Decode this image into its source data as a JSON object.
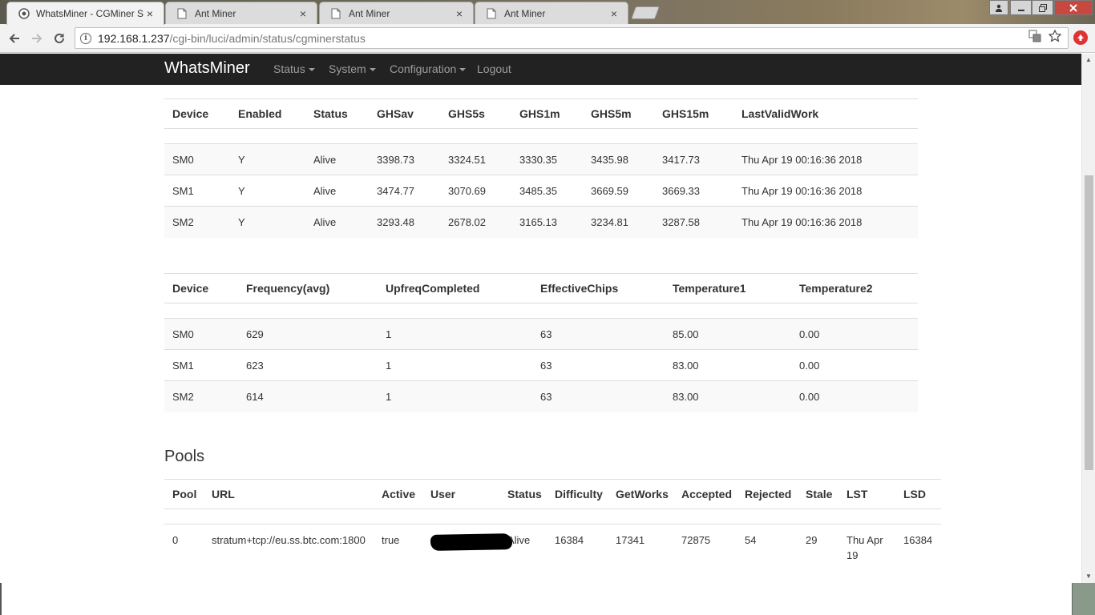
{
  "browser": {
    "tabs": [
      {
        "title": "WhatsMiner - CGMiner S",
        "icon": "miner-favicon",
        "active": true
      },
      {
        "title": "Ant Miner",
        "icon": "page-icon",
        "active": false
      },
      {
        "title": "Ant Miner",
        "icon": "page-icon",
        "active": false
      },
      {
        "title": "Ant Miner",
        "icon": "page-icon",
        "active": false
      }
    ],
    "url_host": "192.168.1.237",
    "url_path": "/cgi-bin/luci/admin/status/cgminerstatus",
    "close_glyph": "×"
  },
  "navbar": {
    "brand": "WhatsMiner",
    "links": [
      {
        "label": "Status",
        "dropdown": true
      },
      {
        "label": "System",
        "dropdown": true
      },
      {
        "label": "Configuration",
        "dropdown": true
      },
      {
        "label": "Logout",
        "dropdown": false
      }
    ]
  },
  "devices_hashrate": {
    "headers": [
      "Device",
      "Enabled",
      "Status",
      "GHSav",
      "GHS5s",
      "GHS1m",
      "GHS5m",
      "GHS15m",
      "LastValidWork"
    ],
    "rows": [
      [
        "SM0",
        "Y",
        "Alive",
        "3398.73",
        "3324.51",
        "3330.35",
        "3435.98",
        "3417.73",
        "Thu Apr 19 00:16:36 2018"
      ],
      [
        "SM1",
        "Y",
        "Alive",
        "3474.77",
        "3070.69",
        "3485.35",
        "3669.59",
        "3669.33",
        "Thu Apr 19 00:16:36 2018"
      ],
      [
        "SM2",
        "Y",
        "Alive",
        "3293.48",
        "2678.02",
        "3165.13",
        "3234.81",
        "3287.58",
        "Thu Apr 19 00:16:36 2018"
      ]
    ]
  },
  "devices_chips": {
    "headers": [
      "Device",
      "Frequency(avg)",
      "UpfreqCompleted",
      "EffectiveChips",
      "Temperature1",
      "Temperature2"
    ],
    "rows": [
      [
        "SM0",
        "629",
        "1",
        "63",
        "85.00",
        "0.00"
      ],
      [
        "SM1",
        "623",
        "1",
        "63",
        "83.00",
        "0.00"
      ],
      [
        "SM2",
        "614",
        "1",
        "63",
        "83.00",
        "0.00"
      ]
    ]
  },
  "pools": {
    "title": "Pools",
    "headers": [
      "Pool",
      "URL",
      "Active",
      "User",
      "Status",
      "Difficulty",
      "GetWorks",
      "Accepted",
      "Rejected",
      "Stale",
      "LST",
      "LSD"
    ],
    "rows": [
      {
        "pool": "0",
        "url": "stratum+tcp://eu.ss.btc.com:1800",
        "active": "true",
        "user_redacted": true,
        "status": "Alive",
        "difficulty": "16384",
        "getworks": "17341",
        "accepted": "72875",
        "rejected": "54",
        "stale": "29",
        "lst": "Thu Apr 19",
        "lsd": "16384"
      }
    ]
  }
}
